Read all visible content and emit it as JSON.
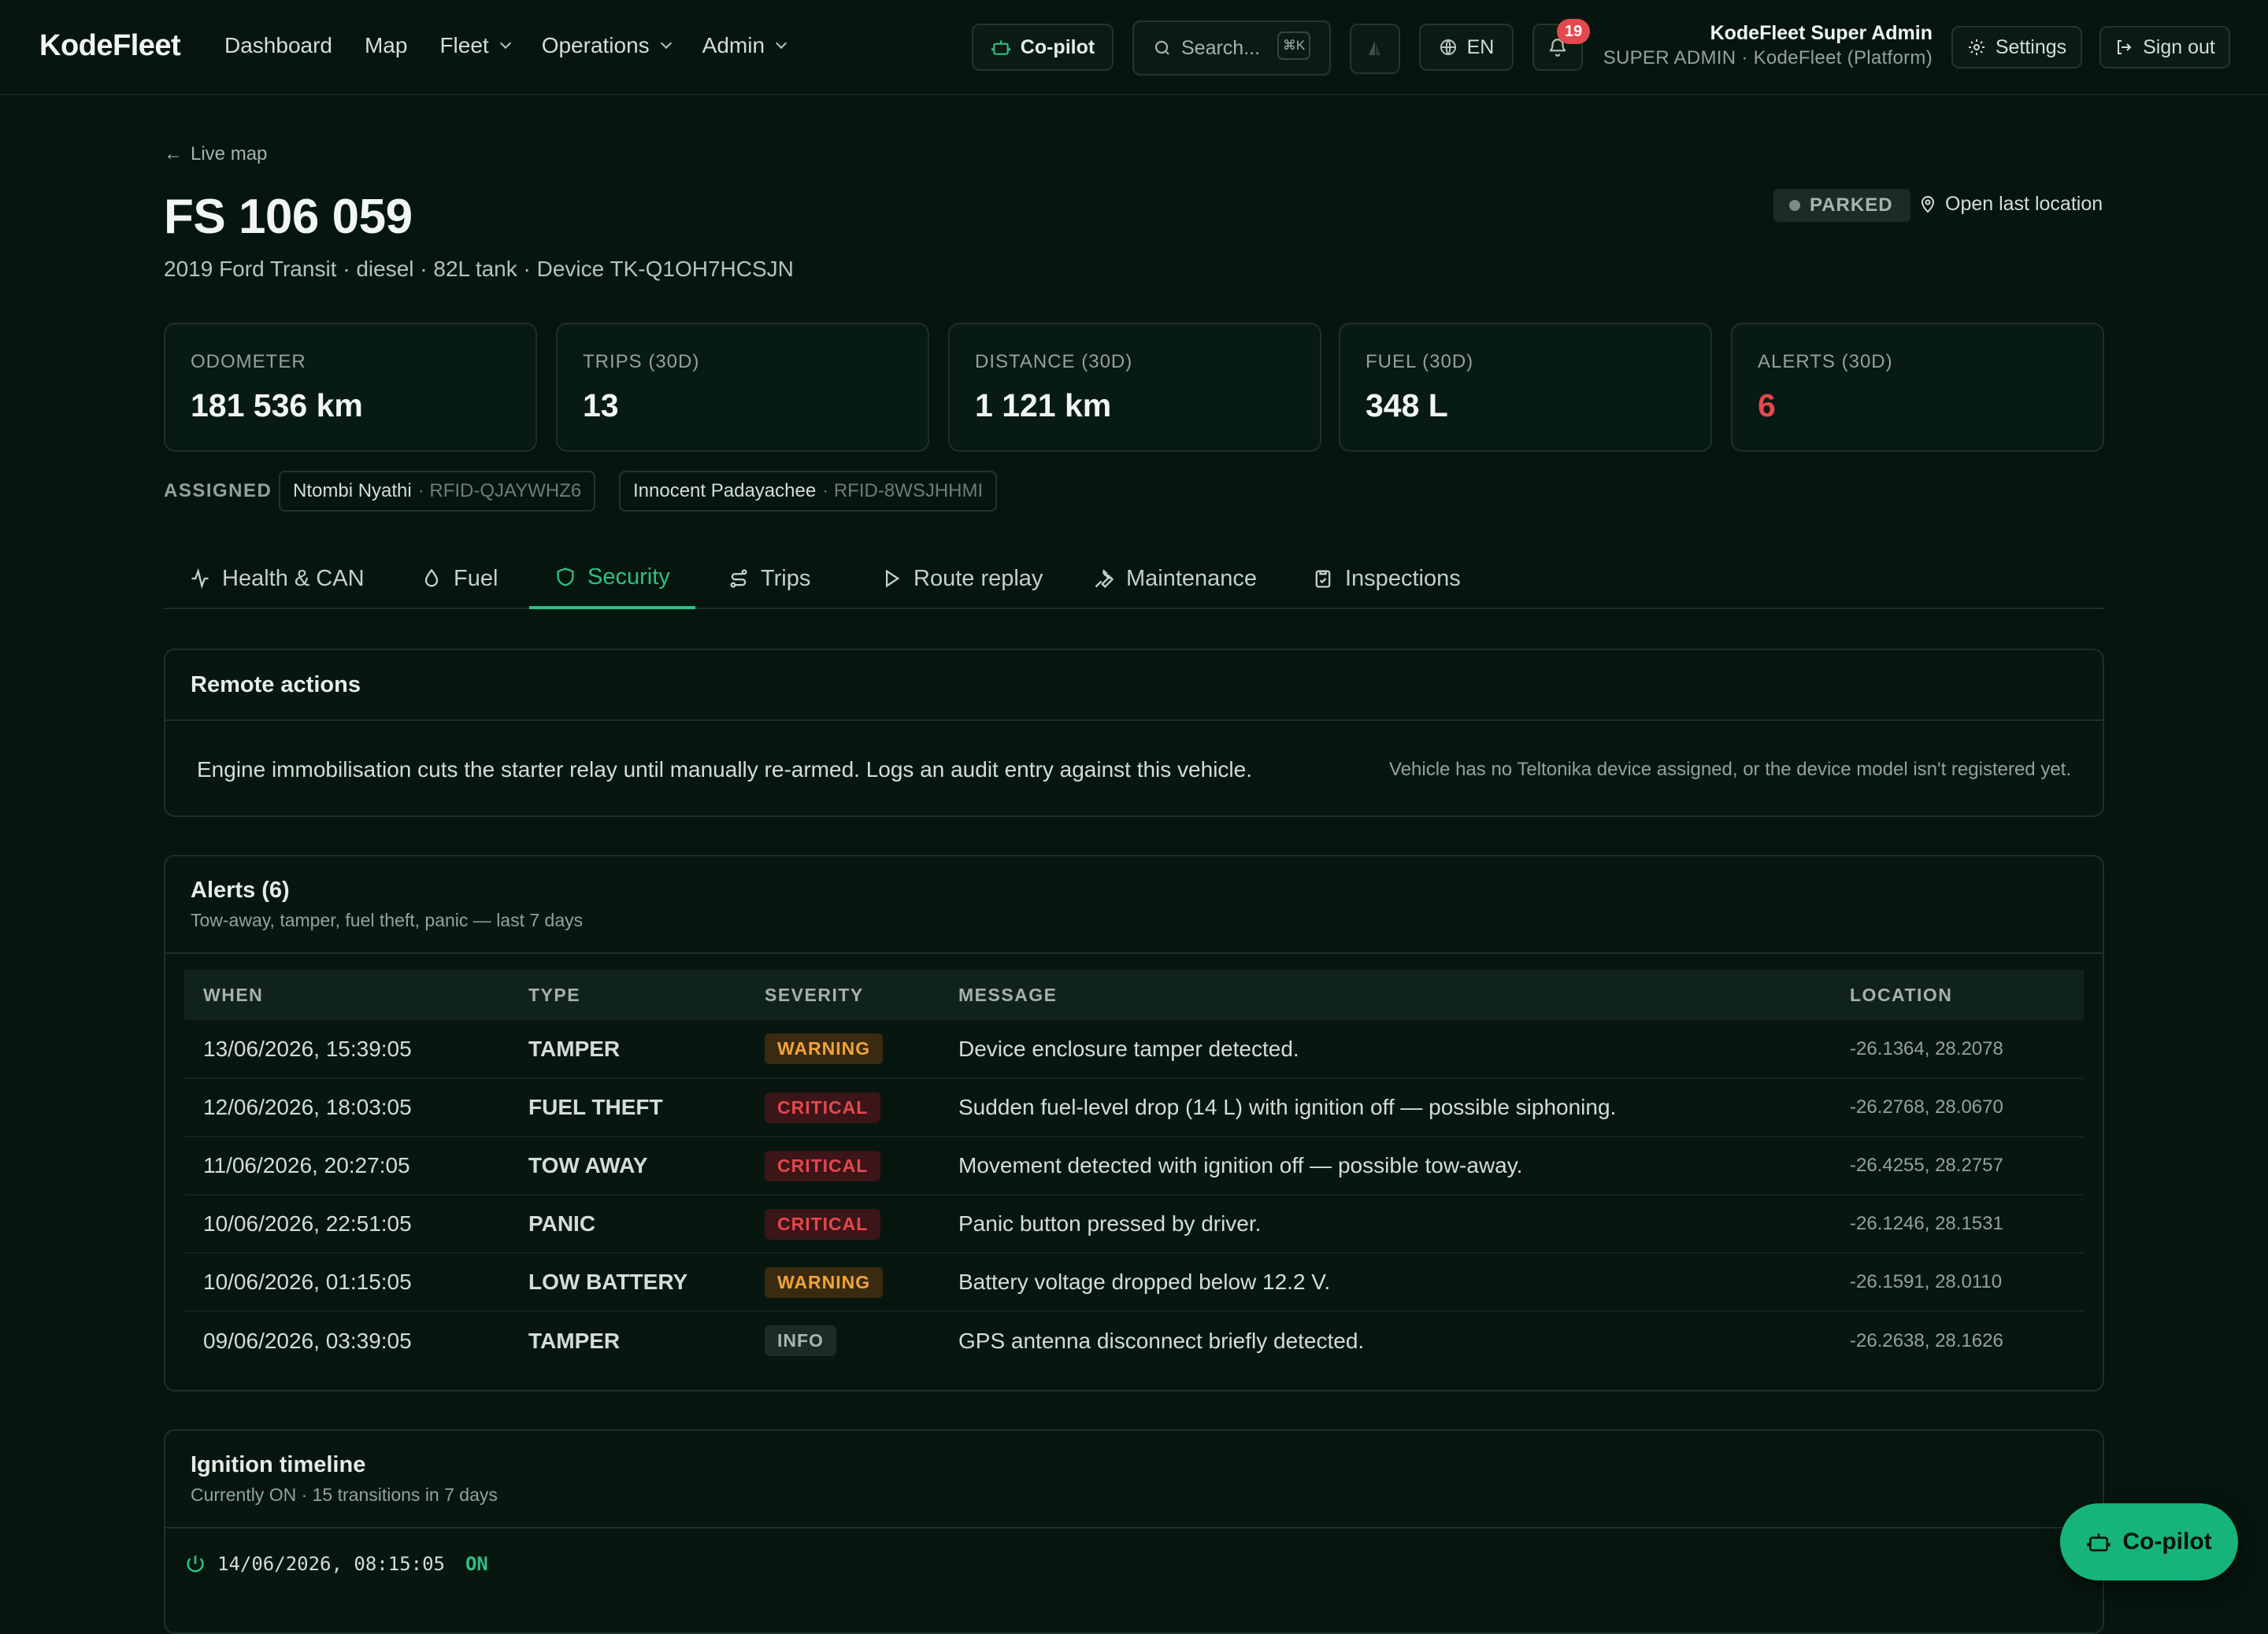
{
  "app": {
    "brand": "KodeFleet"
  },
  "nav": {
    "dashboard": "Dashboard",
    "map": "Map",
    "fleet": "Fleet",
    "operations": "Operations",
    "admin": "Admin"
  },
  "topbar": {
    "copilot": "Co-pilot",
    "search_placeholder": "Search...",
    "search_kbd": "⌘K",
    "language": "EN",
    "notifications_count": "19",
    "user_name": "KodeFleet Super Admin",
    "user_role": "SUPER ADMIN · KodeFleet (Platform)",
    "settings": "Settings",
    "signout": "Sign out"
  },
  "vehicle": {
    "back_label": "Live map",
    "title": "FS 106 059",
    "subtitle": "2019 Ford Transit · diesel · 82L tank · Device TK-Q1OH7HCSJN",
    "status": "PARKED",
    "open_location": "Open last location"
  },
  "kpis": [
    {
      "label": "ODOMETER",
      "value": "181 536 km"
    },
    {
      "label": "TRIPS (30D)",
      "value": "13"
    },
    {
      "label": "DISTANCE (30D)",
      "value": "1 121 km"
    },
    {
      "label": "FUEL (30D)",
      "value": "348 L"
    },
    {
      "label": "ALERTS (30D)",
      "value": "6"
    }
  ],
  "assigned": {
    "label": "ASSIGNED",
    "drivers": [
      {
        "name": "Ntombi Nyathi",
        "rfid": "· RFID-QJAYWHZ6"
      },
      {
        "name": "Innocent Padayachee",
        "rfid": "· RFID-8WSJHHMI"
      }
    ]
  },
  "tabs": [
    "Health & CAN",
    "Fuel",
    "Security",
    "Trips",
    "Route replay",
    "Maintenance",
    "Inspections"
  ],
  "active_tab": "Security",
  "remote": {
    "title": "Remote actions",
    "text": "Engine immobilisation cuts the starter relay until manually re-armed. Logs an audit entry against this vehicle.",
    "note": "Vehicle has no Teltonika device assigned, or the device model isn't registered yet."
  },
  "alerts": {
    "title": "Alerts (6)",
    "subtitle": "Tow-away, tamper, fuel theft, panic — last 7 days",
    "columns": [
      "WHEN",
      "TYPE",
      "SEVERITY",
      "MESSAGE",
      "LOCATION"
    ],
    "rows": [
      {
        "when": "13/06/2026, 15:39:05",
        "type": "TAMPER",
        "severity": "WARNING",
        "message": "Device enclosure tamper detected.",
        "location": "-26.1364, 28.2078"
      },
      {
        "when": "12/06/2026, 18:03:05",
        "type": "FUEL THEFT",
        "severity": "CRITICAL",
        "message": "Sudden fuel-level drop (14 L) with ignition off — possible siphoning.",
        "location": "-26.2768, 28.0670"
      },
      {
        "when": "11/06/2026, 20:27:05",
        "type": "TOW AWAY",
        "severity": "CRITICAL",
        "message": "Movement detected with ignition off — possible tow-away.",
        "location": "-26.4255, 28.2757"
      },
      {
        "when": "10/06/2026, 22:51:05",
        "type": "PANIC",
        "severity": "CRITICAL",
        "message": "Panic button pressed by driver.",
        "location": "-26.1246, 28.1531"
      },
      {
        "when": "10/06/2026, 01:15:05",
        "type": "LOW BATTERY",
        "severity": "WARNING",
        "message": "Battery voltage dropped below 12.2 V.",
        "location": "-26.1591, 28.0110"
      },
      {
        "when": "09/06/2026, 03:39:05",
        "type": "TAMPER",
        "severity": "INFO",
        "message": "GPS antenna disconnect briefly detected.",
        "location": "-26.2638, 28.1626"
      }
    ]
  },
  "ignition": {
    "title": "Ignition timeline",
    "subtitle": "Currently ON · 15 transitions in 7 days",
    "first_entry": {
      "time": "14/06/2026, 08:15:05",
      "state": "ON"
    }
  },
  "fab": {
    "label": "Co-pilot"
  },
  "colors": {
    "accent": "#2fbf84",
    "critical": "#e5484d",
    "warning": "#f2a33a",
    "background": "#06160f"
  }
}
